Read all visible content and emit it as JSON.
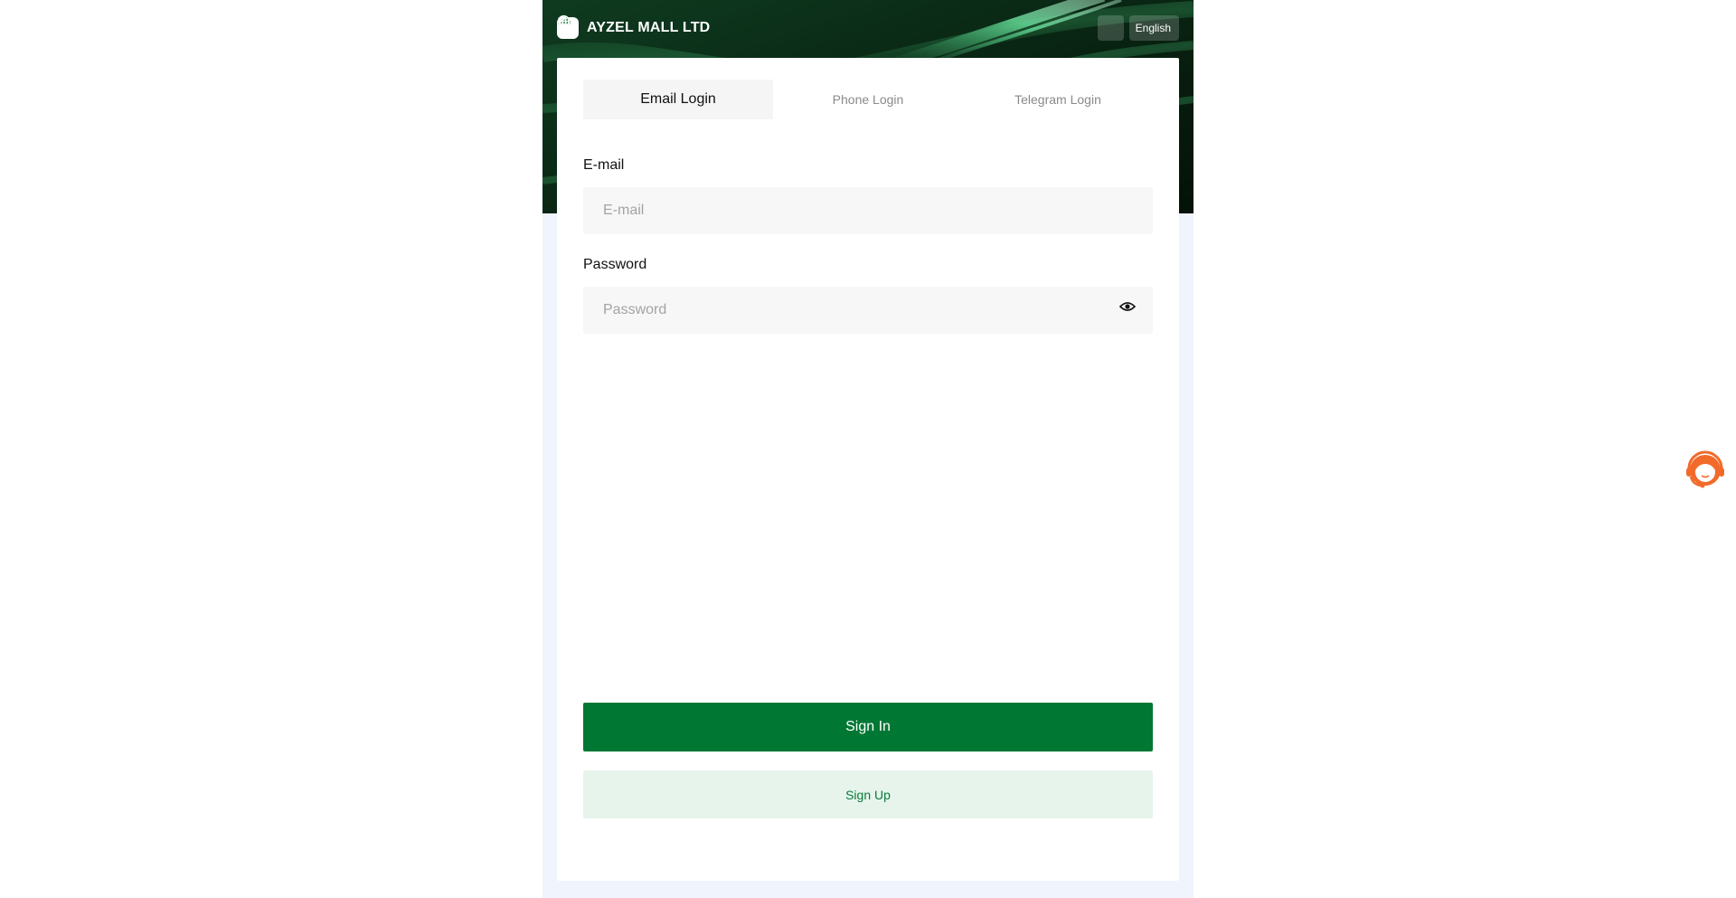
{
  "header": {
    "brand_name": "AYZEL MALL LTD",
    "language_label": "English",
    "icons": {
      "logo": "brand-logo",
      "support": "headset-icon",
      "language": "globe-icon",
      "dropdown": "chevron-down-icon"
    }
  },
  "tabs": [
    {
      "label": "Email Login",
      "active": true
    },
    {
      "label": "Phone Login",
      "active": false
    },
    {
      "label": "Telegram Login",
      "active": false
    }
  ],
  "form": {
    "email": {
      "label": "E-mail",
      "placeholder": "E-mail",
      "value": ""
    },
    "password": {
      "label": "Password",
      "placeholder": "Password",
      "value": "",
      "toggle_icon": "eye-icon"
    }
  },
  "actions": {
    "sign_in_label": "Sign In",
    "sign_up_label": "Sign Up"
  },
  "floating": {
    "icon": "customer-service-icon"
  },
  "colors": {
    "primary": "#007834",
    "secondary_bg": "#e6f4ec",
    "page_bg": "#eff4fd",
    "support_orange": "#f26a2a"
  }
}
